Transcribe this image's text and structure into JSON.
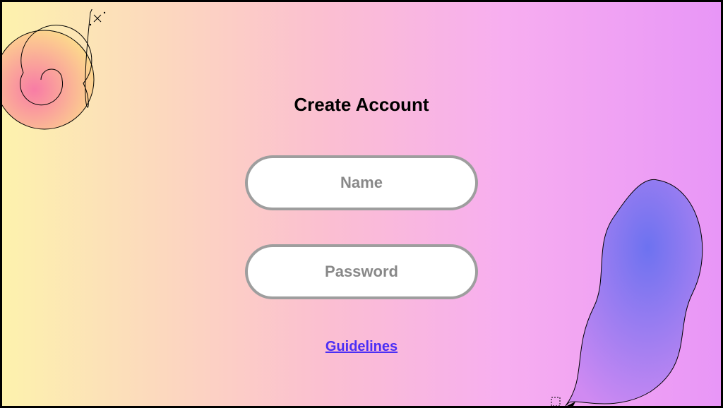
{
  "form": {
    "title": "Create Account",
    "name_placeholder": "Name",
    "password_placeholder": "Password",
    "guidelines_label": "Guidelines"
  }
}
